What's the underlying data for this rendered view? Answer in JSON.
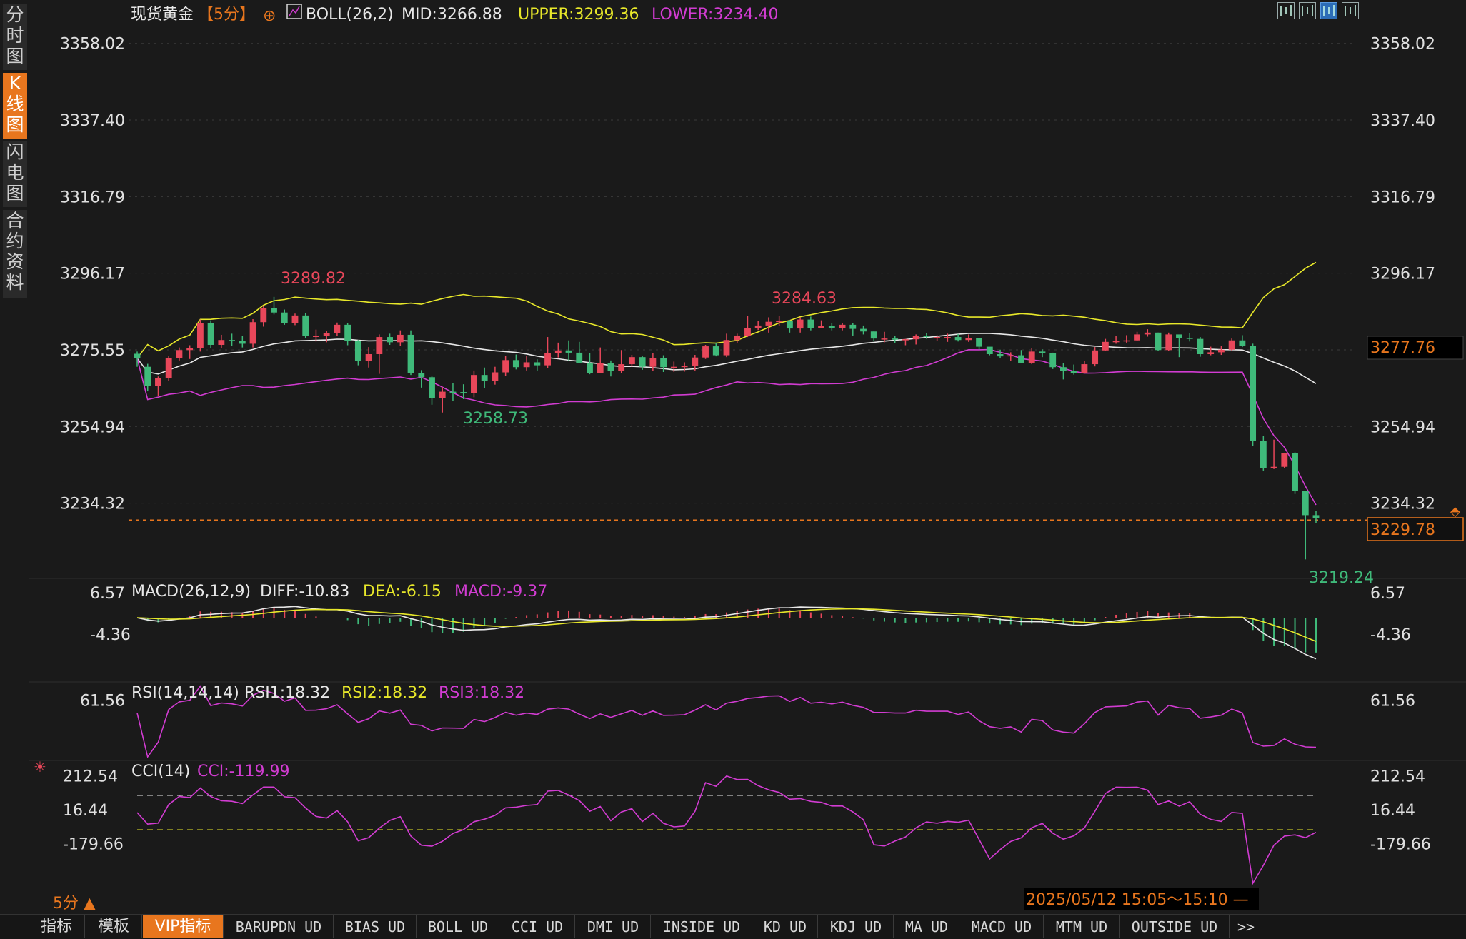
{
  "chart_data": {
    "type": "candlestick",
    "symbol": "现货黄金",
    "period": "【5分】",
    "price_axis": {
      "ticks": [
        "3358.02",
        "3337.40",
        "3316.79",
        "3296.17",
        "3275.55",
        "3254.94",
        "3234.32"
      ],
      "ylim": [
        3216,
        3362
      ],
      "current_close_tag": "3229.78",
      "mid_tag": "3277.76"
    },
    "boll": {
      "label": "BOLL(26,2)",
      "mid_label": "MID:3266.88",
      "upper_label": "UPPER:3299.36",
      "lower_label": "LOWER:3234.40",
      "upper_color": "#e8e82a",
      "mid_color": "#e8e8e8",
      "lower_color": "#d23cd2"
    },
    "candles": [
      [
        3274.5,
        3273.3,
        3275.1,
        3271.0
      ],
      [
        3271.0,
        3265.9,
        3271.8,
        3264.4
      ],
      [
        3265.9,
        3268.0,
        3268.4,
        3263.1
      ],
      [
        3268.0,
        3273.3,
        3274.0,
        3267.2
      ],
      [
        3273.3,
        3275.5,
        3276.2,
        3272.7
      ],
      [
        3275.5,
        3276.0,
        3276.8,
        3273.1
      ],
      [
        3276.0,
        3282.7,
        3283.7,
        3275.1
      ],
      [
        3282.7,
        3276.9,
        3283.5,
        3276.1
      ],
      [
        3276.9,
        3278.2,
        3279.6,
        3276.1
      ],
      [
        3278.2,
        3277.9,
        3279.9,
        3276.6
      ],
      [
        3277.9,
        3277.2,
        3279.3,
        3276.2
      ],
      [
        3277.2,
        3283.0,
        3283.8,
        3276.2
      ],
      [
        3283.0,
        3286.7,
        3287.3,
        3281.8
      ],
      [
        3286.7,
        3285.6,
        3289.8,
        3285.1
      ],
      [
        3285.6,
        3282.7,
        3286.4,
        3282.3
      ],
      [
        3282.7,
        3284.8,
        3285.3,
        3282.2
      ],
      [
        3284.8,
        3279.2,
        3285.5,
        3278.8
      ],
      [
        3279.2,
        3279.3,
        3281.0,
        3277.8
      ],
      [
        3279.3,
        3280.1,
        3280.6,
        3277.6
      ],
      [
        3280.1,
        3282.3,
        3282.9,
        3279.3
      ],
      [
        3282.3,
        3277.9,
        3282.7,
        3276.8
      ],
      [
        3277.9,
        3272.5,
        3278.2,
        3271.4
      ],
      [
        3272.5,
        3274.4,
        3276.3,
        3270.8
      ],
      [
        3274.4,
        3279.0,
        3279.7,
        3269.1
      ],
      [
        3279.0,
        3277.6,
        3279.9,
        3276.9
      ],
      [
        3277.6,
        3279.6,
        3280.8,
        3276.6
      ],
      [
        3279.6,
        3269.3,
        3280.8,
        3268.8
      ],
      [
        3269.3,
        3268.2,
        3270.1,
        3265.4
      ],
      [
        3268.2,
        3262.6,
        3268.4,
        3260.8
      ],
      [
        3262.6,
        3264.3,
        3265.5,
        3258.7
      ],
      [
        3264.3,
        3264.2,
        3266.7,
        3261.9
      ],
      [
        3264.2,
        3263.9,
        3266.3,
        3262.3
      ],
      [
        3263.9,
        3268.8,
        3270.0,
        3262.8
      ],
      [
        3268.8,
        3267.1,
        3270.8,
        3265.3
      ],
      [
        3267.1,
        3269.5,
        3271.0,
        3266.2
      ],
      [
        3269.5,
        3272.8,
        3273.9,
        3268.6
      ],
      [
        3272.8,
        3270.9,
        3274.3,
        3270.3
      ],
      [
        3270.9,
        3272.2,
        3273.9,
        3270.0
      ],
      [
        3272.2,
        3271.4,
        3273.0,
        3270.0
      ],
      [
        3271.4,
        3274.6,
        3279.0,
        3270.6
      ],
      [
        3274.6,
        3275.4,
        3277.5,
        3273.5
      ],
      [
        3275.4,
        3274.8,
        3278.1,
        3272.7
      ],
      [
        3274.8,
        3272.1,
        3277.7,
        3271.9
      ],
      [
        3272.1,
        3269.4,
        3274.7,
        3269.0
      ],
      [
        3269.4,
        3271.9,
        3276.2,
        3269.7
      ],
      [
        3271.9,
        3269.9,
        3272.7,
        3268.4
      ],
      [
        3269.9,
        3271.7,
        3275.5,
        3269.3
      ],
      [
        3271.7,
        3273.6,
        3274.2,
        3271.0
      ],
      [
        3273.6,
        3271.0,
        3273.8,
        3270.2
      ],
      [
        3271.0,
        3273.4,
        3274.6,
        3269.9
      ],
      [
        3273.4,
        3270.9,
        3274.1,
        3269.6
      ],
      [
        3270.9,
        3271.0,
        3272.4,
        3269.6
      ],
      [
        3271.0,
        3271.2,
        3272.2,
        3269.7
      ],
      [
        3271.2,
        3273.5,
        3274.2,
        3270.0
      ],
      [
        3273.5,
        3276.5,
        3276.9,
        3273.1
      ],
      [
        3276.5,
        3274.1,
        3277.4,
        3273.8
      ],
      [
        3274.1,
        3278.2,
        3279.9,
        3273.6
      ],
      [
        3278.2,
        3279.4,
        3279.9,
        3277.3
      ],
      [
        3279.4,
        3281.4,
        3284.6,
        3279.0
      ],
      [
        3281.4,
        3282.1,
        3283.3,
        3280.9
      ],
      [
        3282.1,
        3283.1,
        3284.3,
        3280.2
      ],
      [
        3283.1,
        3283.3,
        3284.7,
        3281.9
      ],
      [
        3283.3,
        3281.3,
        3283.6,
        3280.2
      ],
      [
        3281.3,
        3283.7,
        3284.3,
        3280.2
      ],
      [
        3283.7,
        3281.5,
        3284.5,
        3280.8
      ],
      [
        3281.5,
        3282.0,
        3283.5,
        3281.6
      ],
      [
        3282.0,
        3281.4,
        3282.7,
        3280.8
      ],
      [
        3281.4,
        3282.3,
        3282.7,
        3280.8
      ],
      [
        3282.3,
        3281.2,
        3282.8,
        3279.4
      ],
      [
        3281.2,
        3280.5,
        3282.1,
        3279.7
      ],
      [
        3280.5,
        3278.6,
        3280.5,
        3277.8
      ],
      [
        3278.6,
        3278.6,
        3280.4,
        3277.6
      ],
      [
        3278.6,
        3278.4,
        3279.2,
        3277.3
      ],
      [
        3278.4,
        3278.4,
        3278.5,
        3276.8
      ],
      [
        3278.4,
        3279.3,
        3279.7,
        3277.0
      ],
      [
        3279.3,
        3279.0,
        3280.1,
        3278.5
      ],
      [
        3279.0,
        3279.0,
        3279.5,
        3277.9
      ],
      [
        3279.0,
        3279.0,
        3279.9,
        3277.7
      ],
      [
        3279.0,
        3278.2,
        3279.8,
        3277.8
      ],
      [
        3278.2,
        3278.8,
        3279.7,
        3277.7
      ],
      [
        3278.8,
        3276.4,
        3278.8,
        3275.6
      ],
      [
        3276.4,
        3274.4,
        3276.3,
        3274.1
      ],
      [
        3274.4,
        3273.8,
        3275.6,
        3273.3
      ],
      [
        3273.8,
        3274.1,
        3274.9,
        3272.6
      ],
      [
        3274.1,
        3272.1,
        3275.5,
        3271.9
      ],
      [
        3272.1,
        3275.1,
        3276.0,
        3271.7
      ],
      [
        3275.1,
        3274.7,
        3275.7,
        3273.6
      ],
      [
        3274.7,
        3270.9,
        3274.8,
        3270.4
      ],
      [
        3270.9,
        3269.8,
        3271.9,
        3267.6
      ],
      [
        3269.8,
        3269.3,
        3271.6,
        3268.9
      ],
      [
        3269.3,
        3271.7,
        3272.6,
        3269.4
      ],
      [
        3271.7,
        3275.4,
        3276.3,
        3271.1
      ],
      [
        3275.4,
        3277.7,
        3278.5,
        3275.3
      ],
      [
        3277.7,
        3277.9,
        3279.2,
        3277.2
      ],
      [
        3277.9,
        3278.1,
        3279.5,
        3277.5
      ],
      [
        3278.1,
        3279.7,
        3280.4,
        3278.0
      ],
      [
        3279.7,
        3280.2,
        3281.1,
        3279.1
      ],
      [
        3280.2,
        3275.5,
        3280.2,
        3275.2
      ],
      [
        3275.5,
        3279.7,
        3280.2,
        3275.3
      ],
      [
        3279.7,
        3278.8,
        3279.3,
        3273.6
      ],
      [
        3278.8,
        3278.5,
        3280.0,
        3277.8
      ],
      [
        3278.5,
        3274.4,
        3279.0,
        3273.7
      ],
      [
        3274.4,
        3274.9,
        3276.4,
        3274.1
      ],
      [
        3274.9,
        3275.6,
        3276.7,
        3274.2
      ],
      [
        3275.6,
        3278.1,
        3278.6,
        3275.3
      ],
      [
        3278.1,
        3276.6,
        3279.5,
        3276.3
      ],
      [
        3276.6,
        3251.1,
        3277.2,
        3249.7
      ],
      [
        3251.1,
        3243.7,
        3252.4,
        3243.1
      ],
      [
        3243.7,
        3244.1,
        3251.4,
        3243.5
      ],
      [
        3244.1,
        3247.7,
        3247.9,
        3243.8
      ],
      [
        3247.7,
        3237.6,
        3248.0,
        3236.8
      ],
      [
        3237.6,
        3231.1,
        3236.1,
        3219.2
      ],
      [
        3231.1,
        3230.3,
        3232.3,
        3228.9
      ]
    ],
    "annotations": {
      "high": "3289.82",
      "low_left": "3258.73",
      "high_mid": "3284.63",
      "low_right": "3219.24"
    },
    "macd": {
      "label": "MACD(26,12,9)",
      "diff_label": "DIFF:-10.83",
      "dea_label": "DEA:-6.15",
      "macd_label": "MACD:-9.37",
      "ticks": [
        "6.57",
        "-4.36"
      ],
      "ylim": [
        -16,
        8.5
      ],
      "tick_values": [
        6.57,
        -4.36
      ]
    },
    "rsi": {
      "label": "RSI(14,14,14)",
      "rsi1_label": "RSI1:18.32",
      "rsi2_label": "RSI2:18.32",
      "rsi3_label": "RSI3:18.32",
      "ticks": [
        "61.56"
      ],
      "ylim": [
        10,
        75
      ],
      "tick_values": [
        61.56
      ]
    },
    "cci": {
      "label": "CCI(14)",
      "value_label": "CCI:-119.99",
      "ticks": [
        "212.54",
        "16.44",
        "-179.66"
      ],
      "ylim": [
        -420,
        280
      ],
      "tick_values": [
        212.54,
        16.44,
        -179.66
      ],
      "upper_ref": 100,
      "lower_ref": -100
    },
    "up_color": "#e8475a",
    "down_color": "#3fba7a"
  },
  "time_label": "2025/05/12 15:05～15:10 —",
  "period_indicator": "5分 ▲",
  "sidebar": {
    "tabs": [
      {
        "label": "分时图"
      },
      {
        "label": "K线图"
      },
      {
        "label": "闪电图"
      },
      {
        "label": "合约资料"
      }
    ]
  },
  "bottom_tabs": [
    "指标",
    "模板",
    "VIP指标",
    "BARUPDN_UD",
    "BIAS_UD",
    "BOLL_UD",
    "CCI_UD",
    "DMI_UD",
    "INSIDE_UD",
    "KD_UD",
    "KDJ_UD",
    "MA_UD",
    "MACD_UD",
    "MTM_UD",
    "OUTSIDE_UD",
    ">>"
  ],
  "toolbar_icons": [
    "grid-layout-icon",
    "chart-compare-icon",
    "candle-toggle-icon",
    "expand-icon"
  ]
}
